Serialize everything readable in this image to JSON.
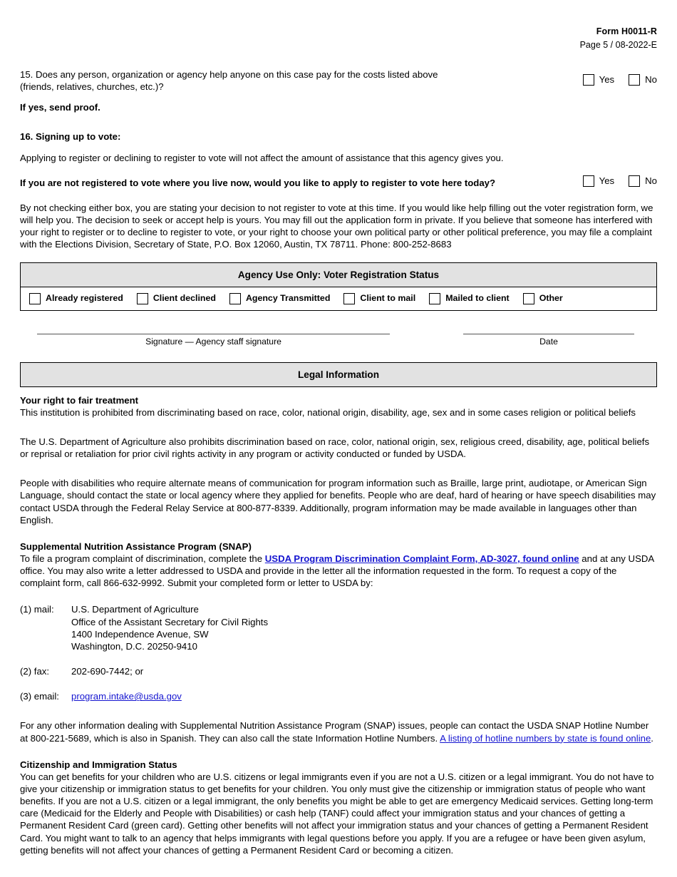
{
  "header": {
    "form_id": "Form H0011-R",
    "page_line": "Page 5  / 08-2022-E"
  },
  "q15": {
    "text_line1": "15. Does any person, organization or agency help anyone on this case pay for the costs listed above",
    "text_line2": "(friends, relatives, churches, etc.)?",
    "note": "If yes, send proof.",
    "yes_label": "Yes",
    "no_label": "No"
  },
  "q16": {
    "heading": "16. Signing up to vote:",
    "intro": "Applying to register or declining to register to vote will not affect the amount of assistance that this agency gives you.",
    "question": "If you are not registered to vote where you live now, would you like to apply to register to vote here today?",
    "yes_label": "Yes",
    "no_label": "No",
    "disclaimer": "By not checking either box, you are stating your decision to not register to vote at this time. If you would like help filling out the voter registration form, we will help you. The decision to seek or accept help is yours. You may fill out the application form in private. If you believe that someone has interfered with your right to register or to decline to register to vote, or your right to choose your own political party or other political preference, you may file a complaint with the Elections Division, Secretary of State, P.O. Box 12060, Austin, TX 78711. Phone: 800-252-8683"
  },
  "agency_box": {
    "title": "Agency Use Only: Voter Registration Status",
    "options": [
      "Already registered",
      "Client declined",
      "Agency Transmitted",
      "Client to mail",
      "Mailed to client",
      "Other"
    ]
  },
  "signature": {
    "signature_caption": "Signature — Agency staff signature",
    "date_caption": "Date"
  },
  "legal": {
    "bar_title": "Legal Information",
    "fair_treatment_heading": "Your right to fair treatment",
    "fair_treatment_body": "This institution is prohibited from discriminating based on race, color, national origin, disability, age, sex and in some cases religion or political beliefs",
    "usda_paragraph": "The U.S. Department of Agriculture also prohibits discrimination based on race, color, national origin, sex, religious creed, disability, age, political beliefs or reprisal or retaliation for prior civil rights activity in any program or activity conducted or funded by USDA.",
    "disabilities_paragraph": "People with disabilities who require alternate means of communication for program information such as Braille, large print, audiotape, or American Sign Language, should contact the state or local agency where they applied for benefits. People who are deaf, hard of hearing or have speech disabilities may contact USDA through the Federal Relay Service at 800-877-8339. Additionally, program information may be made available in languages other than English.",
    "snap_heading": "Supplemental Nutrition Assistance Program (SNAP)",
    "snap_text_before_link": "To file a program complaint of discrimination, complete the ",
    "snap_link_text": "USDA Program Discrimination Complaint Form, AD-3027, found online",
    "snap_text_after_link": " and at any USDA office. You may also write a letter addressed to USDA and provide in the letter all the information requested in the form. To request a copy of the complaint form, call 866-632-9992. Submit your completed form or letter to USDA by:",
    "mail_label": "(1) mail:",
    "mail_lines": [
      "U.S. Department of Agriculture",
      "Office of the Assistant Secretary for Civil Rights",
      "1400 Independence Avenue, SW",
      "Washington, D.C. 20250-9410"
    ],
    "fax_label": "(2) fax:",
    "fax_value": "202-690-7442; or",
    "email_label": "(3) email:",
    "email_value": "program.intake@usda.gov",
    "hotline_text_before_link": "For any other information dealing with Supplemental Nutrition Assistance Program (SNAP) issues, people can contact the USDA SNAP Hotline Number at 800-221-5689, which is also in Spanish. They can also call the state Information Hotline Numbers. ",
    "hotline_link_text": "A listing of hotline numbers by state is found online",
    "hotline_text_after_link": ".",
    "citizenship_heading": "Citizenship and Immigration Status",
    "citizenship_body": "You can get benefits for your children who are U.S. citizens or legal immigrants even if you are not a U.S. citizen or a legal immigrant. You do not have to give your citizenship or immigration status to get benefits for your children. You only must give the citizenship or immigration status of people who want benefits. If you are not a U.S. citizen or a legal immigrant, the only benefits you might be able to get are emergency Medicaid services. Getting long-term care (Medicaid for the Elderly and People with Disabilities) or cash help (TANF) could affect your immigration status and your chances of getting a Permanent Resident Card (green card). Getting other benefits will not affect your immigration status and your chances of getting a Permanent Resident Card. You might want to talk to an agency that helps immigrants with legal questions before you apply. If you are a refugee or have been given asylum, getting benefits will not affect your chances of getting a Permanent Resident Card or becoming a citizen."
  },
  "colors": {
    "bar_background": "#e2e2e2",
    "link": "#1515d0",
    "border": "#000000"
  }
}
